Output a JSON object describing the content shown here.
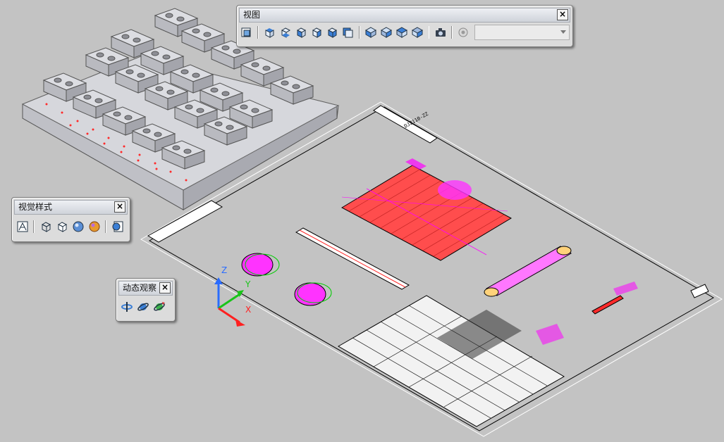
{
  "colors": {
    "background": "#c3c3c3",
    "drawing_lines": "#000000",
    "annotation_magenta": "#ff00ff",
    "hatch_red": "#ff3a3a",
    "axis_z": "#2a6cff",
    "axis_y": "#19c419",
    "axis_x": "#ff2020"
  },
  "view_toolbar": {
    "title": "视图",
    "buttons": [
      "named-views-icon",
      "top-view-icon",
      "bottom-view-icon",
      "left-view-icon",
      "right-view-icon",
      "front-view-icon",
      "back-view-icon",
      "sw-iso-icon",
      "se-iso-icon",
      "ne-iso-icon",
      "nw-iso-icon",
      "camera-icon",
      "ucs-view-icon"
    ],
    "dropdown_value": ""
  },
  "visual_style_toolbar": {
    "title": "视觉样式",
    "buttons": [
      "2d-wireframe-icon",
      "3d-wireframe-icon",
      "hidden-icon",
      "realistic-icon",
      "conceptual-icon",
      "visual-style-manager-icon"
    ]
  },
  "orbit_toolbar": {
    "title": "动态观察",
    "buttons": [
      "constrained-orbit-icon",
      "free-orbit-icon",
      "continuous-orbit-icon"
    ]
  },
  "ucs": {
    "z_label": "Z",
    "y_label": "Y",
    "x_label": "X"
  }
}
